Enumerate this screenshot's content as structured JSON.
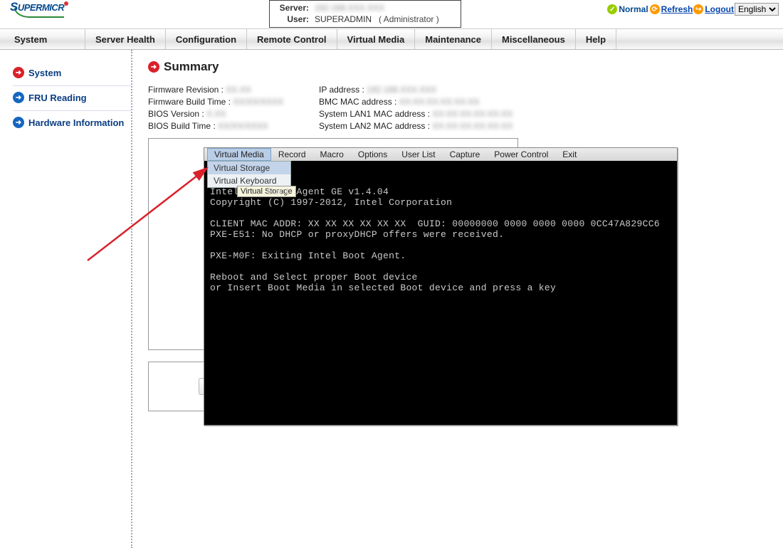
{
  "header": {
    "brand_main": "S",
    "brand_rest": "UPERMICR",
    "server_label": "Server:",
    "user_label": "User:",
    "server_value": "192.168.XXX.XXX",
    "user_value": "SUPERADMIN",
    "user_role": "( Administrator )",
    "status_text": "Normal",
    "refresh_label": "Refresh",
    "logout_label": "Logout",
    "language": "English"
  },
  "menu": {
    "items": [
      "System",
      "Server Health",
      "Configuration",
      "Remote Control",
      "Virtual Media",
      "Maintenance",
      "Miscellaneous",
      "Help"
    ]
  },
  "sidebar": {
    "items": [
      {
        "label": "System",
        "active": true
      },
      {
        "label": "FRU Reading",
        "active": false
      },
      {
        "label": "Hardware Information",
        "active": false
      }
    ]
  },
  "summary": {
    "title": "Summary",
    "col1": [
      {
        "k": "Firmware Revision :",
        "v": "XX.XX"
      },
      {
        "k": "Firmware Build Time :",
        "v": "XX/XX/XXXX"
      },
      {
        "k": "BIOS Version :",
        "v": "X.XX"
      },
      {
        "k": "BIOS Build Time :",
        "v": "XX/XX/XXXX"
      }
    ],
    "col2": [
      {
        "k": "IP address :",
        "v": "192.168.XXX.XXX"
      },
      {
        "k": "BMC MAC address :",
        "v": "XX:XX:XX:XX:XX:XX"
      },
      {
        "k": "System LAN1 MAC address :",
        "v": "XX:XX:XX:XX:XX:XX"
      },
      {
        "k": "System LAN2 MAC address :",
        "v": "XX:XX:XX:XX:XX:XX"
      }
    ]
  },
  "kvm": {
    "menu": [
      "Virtual Media",
      "Record",
      "Macro",
      "Options",
      "User List",
      "Capture",
      "Power Control",
      "Exit"
    ],
    "dropdown": [
      "Virtual Storage",
      "Virtual Keyboard"
    ],
    "tooltip": "Virtual Storage",
    "console": "Intel ... Boot Agent GE v1.4.04\nCopyright (C) 1997-2012, Intel Corporation\n\nCLIENT MAC ADDR: XX XX XX XX XX XX  GUID: 00000000 0000 0000 0000 0CC47A829CC6\nPXE-E51: No DHCP or proxyDHCP offers were received.\n\nPXE-M0F: Exiting Intel Boot Agent.\n\nReboot and Select proper Boot device\nor Insert Boot Media in selected Boot device and press a key"
  }
}
